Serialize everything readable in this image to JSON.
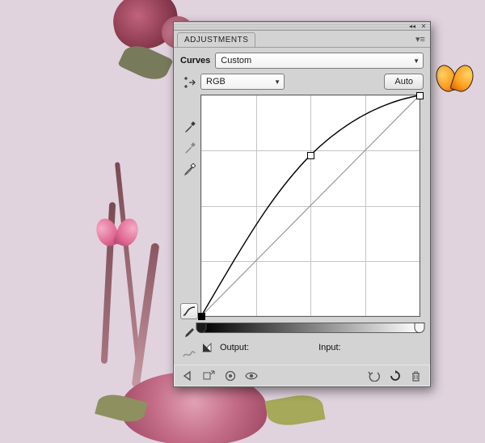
{
  "panel": {
    "tab_label": "ADJUSTMENTS",
    "title": "Curves",
    "preset": "Custom",
    "channel": "RGB",
    "auto_label": "Auto",
    "output_label": "Output:",
    "input_label": "Input:",
    "output_value": "",
    "input_value": ""
  },
  "chart_data": {
    "type": "line",
    "title": "Curves",
    "xlabel": "Input",
    "ylabel": "Output",
    "xlim": [
      0,
      255
    ],
    "ylim": [
      0,
      255
    ],
    "grid": true,
    "series": [
      {
        "name": "baseline",
        "x": [
          0,
          255
        ],
        "y": [
          0,
          255
        ]
      },
      {
        "name": "curve",
        "x": [
          0,
          16,
          32,
          48,
          64,
          80,
          96,
          112,
          128,
          144,
          160,
          176,
          192,
          208,
          224,
          240,
          255
        ],
        "y": [
          0,
          30,
          58,
          85,
          110,
          132,
          152,
          170,
          186,
          200,
          213,
          224,
          234,
          242,
          248,
          253,
          255
        ]
      }
    ],
    "control_points": [
      {
        "x": 0,
        "y": 0
      },
      {
        "x": 128,
        "y": 186
      },
      {
        "x": 255,
        "y": 255
      }
    ]
  }
}
